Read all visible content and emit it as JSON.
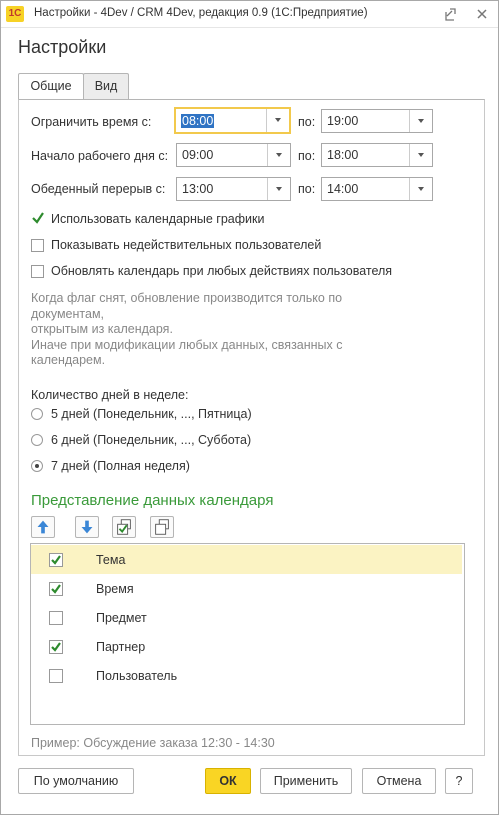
{
  "window": {
    "logo": "1С",
    "title": "Настройки - 4Dev / CRM 4Dev, редакция 0.9  (1С:Предприятие)"
  },
  "page_title": "Настройки",
  "tabs": [
    {
      "label": "Общие",
      "active": true
    },
    {
      "label": "Вид",
      "active": false
    }
  ],
  "time": {
    "limit": {
      "label": "Ограничить время с:",
      "from": "08:00",
      "to_label": "по:",
      "to": "19:00"
    },
    "workday": {
      "label": "Начало рабочего дня с:",
      "from": "09:00",
      "to_label": "по:",
      "to": "18:00"
    },
    "lunch": {
      "label": "Обеденный перерыв с:",
      "from": "13:00",
      "to_label": "по:",
      "to": "14:00"
    }
  },
  "options": [
    {
      "label": "Использовать календарные графики",
      "checked": true
    },
    {
      "label": "Показывать недействительных пользователей",
      "checked": false
    },
    {
      "label": "Обновлять календарь при любых действиях пользователя",
      "checked": false
    }
  ],
  "hint_lines": [
    "Когда флаг снят, обновление производится только по документам,",
    "открытым из календаря.",
    "Иначе при модификации любых данных, связанных с календарем."
  ],
  "week": {
    "label": "Количество дней в неделе:",
    "options": [
      {
        "label": "5 дней (Понедельник, ..., Пятница)",
        "selected": false
      },
      {
        "label": "6 дней (Понедельник, ..., Суббота)",
        "selected": false
      },
      {
        "label": "7 дней (Полная неделя)",
        "selected": true
      }
    ]
  },
  "calendar_view": {
    "title": "Представление данных календаря",
    "toolbar": [
      "move-up-icon",
      "move-down-icon",
      "check-all-icon",
      "uncheck-all-icon"
    ],
    "items": [
      {
        "label": "Тема",
        "checked": true
      },
      {
        "label": "Время",
        "checked": true
      },
      {
        "label": "Предмет",
        "checked": false
      },
      {
        "label": "Партнер",
        "checked": true
      },
      {
        "label": "Пользователь",
        "checked": false
      }
    ],
    "example": "Пример: Обсуждение заказа 12:30 - 14:30"
  },
  "footer": {
    "default": "По умолчанию",
    "ok": "ОК",
    "apply": "Применить",
    "cancel": "Отмена",
    "help": "?"
  },
  "colors": {
    "accent_green": "#3a9a3a",
    "focus_yellow": "#f2c94c",
    "primary_button": "#f9d524",
    "selection_row": "#fbf3c3"
  }
}
